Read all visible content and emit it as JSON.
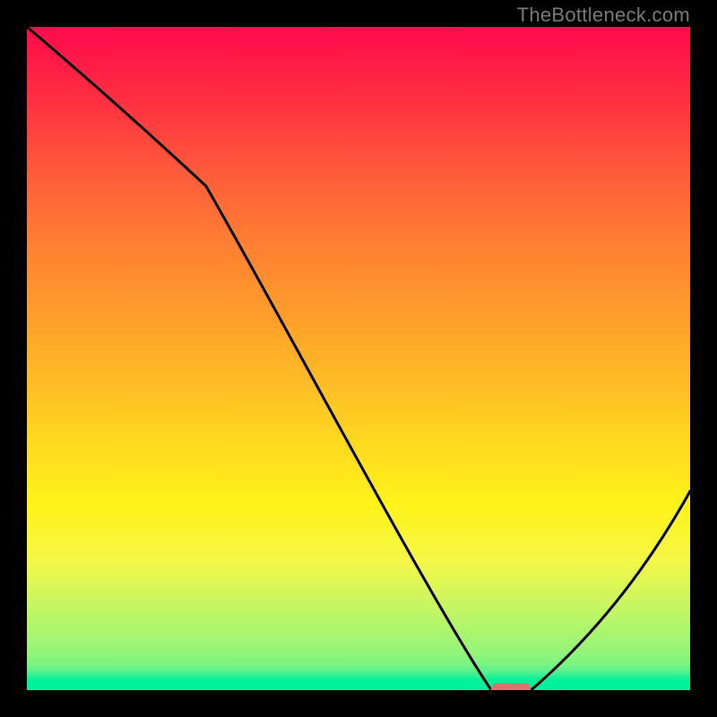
{
  "watermark": "TheBottleneck.com",
  "chart_data": {
    "type": "line",
    "title": "",
    "xlabel": "",
    "ylabel": "",
    "xlim": [
      0,
      100
    ],
    "ylim": [
      0,
      100
    ],
    "x": [
      0,
      27,
      70,
      76,
      100
    ],
    "values": [
      100,
      76,
      0,
      0,
      30
    ],
    "marker": {
      "x_start": 70,
      "x_end": 76,
      "y": 0,
      "color": "#d9746e"
    },
    "background": "vertical-gradient red→orange→yellow→green",
    "grid": false,
    "source": "TheBottleneck.com"
  }
}
